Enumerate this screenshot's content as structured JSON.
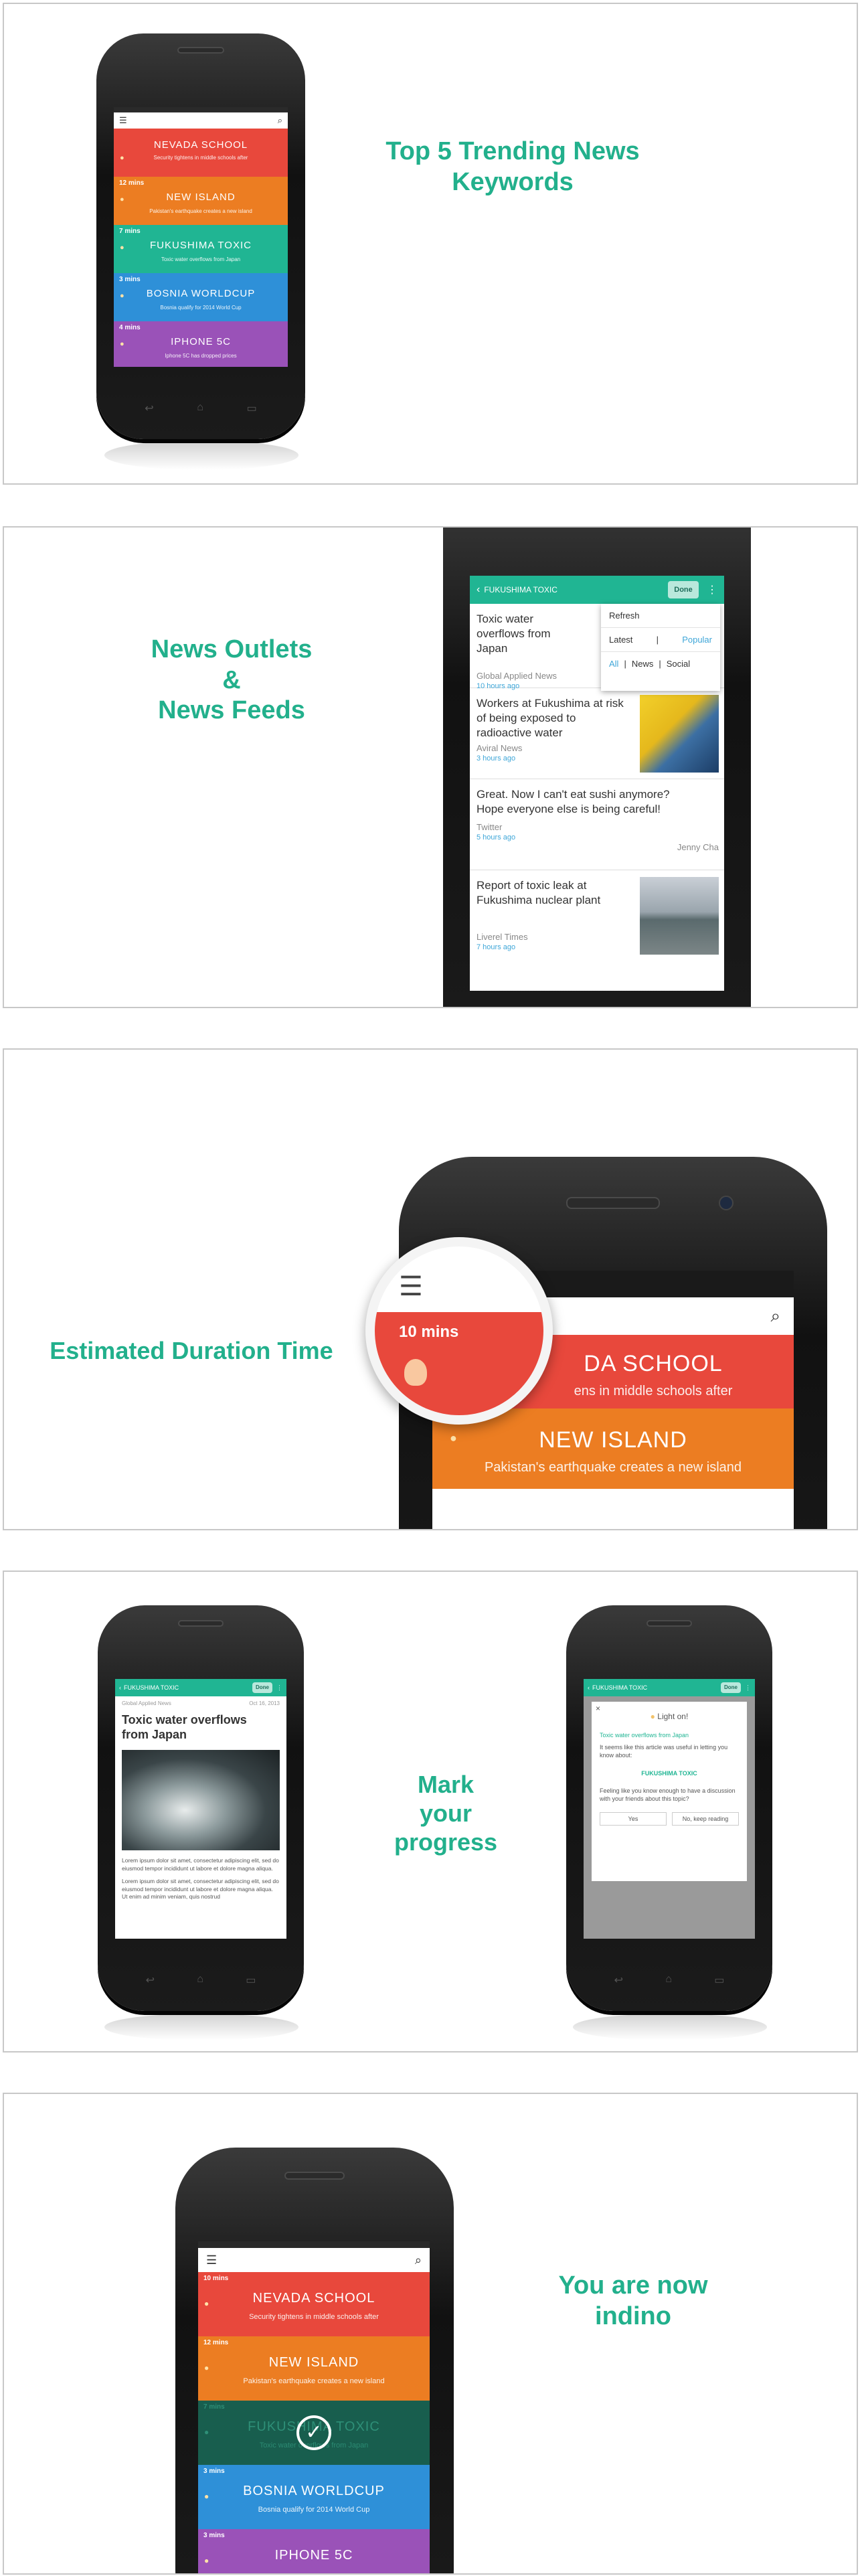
{
  "section1": {
    "caption": "Top 5 Trending News Keywords",
    "items": [
      {
        "time": "",
        "keyword": "NEVADA SCHOOL",
        "subtitle": "Security tightens in middle schools after",
        "color": "#e8483c"
      },
      {
        "time": "12 mins",
        "keyword": "NEW ISLAND",
        "subtitle": "Pakistan's earthquake creates a new island",
        "color": "#ec7d22"
      },
      {
        "time": "7 mins",
        "keyword": "FUKUSHIMA TOXIC",
        "subtitle": "Toxic water overflows from Japan",
        "color": "#20b593"
      },
      {
        "time": "3 mins",
        "keyword": "BOSNIA WORLDCUP",
        "subtitle": "Bosnia qualify for 2014 World Cup",
        "color": "#2e90d8"
      },
      {
        "time": "4 mins",
        "keyword": "IPHONE 5C",
        "subtitle": "Iphone 5C has dropped prices",
        "color": "#9a52b8"
      }
    ]
  },
  "section2": {
    "caption_line1": "News Outlets",
    "caption_line2": "&",
    "caption_line3": "News Feeds",
    "header_title": "FUKUSHIMA TOXIC",
    "done_label": "Done",
    "menu": {
      "refresh": "Refresh",
      "latest": "Latest",
      "sep1": "|",
      "popular": "Popular",
      "all": "All",
      "sep2": "|",
      "news": "News",
      "sep3": "|",
      "social": "Social"
    },
    "feed": [
      {
        "headline": "Toxic water overflows from Japan",
        "source": "Global Applied News",
        "ago": "10 hours ago",
        "author": ""
      },
      {
        "headline": "Workers at Fukushima at risk of being exposed to radioactive water",
        "source": "Aviral News",
        "ago": "3 hours ago",
        "author": ""
      },
      {
        "headline": "Great. Now I can't eat sushi anymore? Hope everyone else is being careful!",
        "source": "Twitter",
        "ago": "5 hours ago",
        "author": "Jenny Cha"
      },
      {
        "headline": "Report of toxic leak at Fukushima nuclear plant",
        "source": "Liverel Times",
        "ago": "7 hours ago",
        "author": ""
      }
    ]
  },
  "section3": {
    "caption": "Estimated Duration Time",
    "magnifier_time": "10 mins",
    "item1_keyword": "DA SCHOOL",
    "item1_subtitle": "ens in middle schools after",
    "item2_keyword": "NEW ISLAND",
    "item2_subtitle": "Pakistan's earthquake creates a new island"
  },
  "section4": {
    "caption_line1": "Mark",
    "caption_line2": "your",
    "caption_line3": "progress",
    "header_title": "FUKUSHIMA TOXIC",
    "done_label": "Done",
    "article": {
      "source": "Global Applied News",
      "date": "Oct 16, 2013",
      "title": "Toxic water overflows from Japan",
      "body1": "Lorem ipsum dolor sit amet, consectetur adipiscing elit, sed do eiusmod tempor incididunt ut labore et dolore magna aliqua.",
      "body2": "Lorem ipsum dolor sit amet, consectetur adipiscing elit, sed do eiusmod tempor incididunt ut labore et dolore magna aliqua. Ut enim ad minim veniam, quis nostrud"
    },
    "dialog": {
      "close": "×",
      "title": "Light on!",
      "article_title": "Toxic water overflows from Japan",
      "question": "It seems like this article was useful in letting you know about:",
      "keyword": "FUKUSHIMA TOXIC",
      "prompt": "Feeling like you know enough to have a discussion with your friends about this topic?",
      "yes": "Yes",
      "no": "No, keep reading"
    }
  },
  "section5": {
    "caption_line1": "You are now",
    "caption_line2": "indino",
    "items": [
      {
        "time": "10 mins",
        "keyword": "NEVADA SCHOOL",
        "subtitle": "Security tightens in middle schools after"
      },
      {
        "time": "12 mins",
        "keyword": "NEW ISLAND",
        "subtitle": "Pakistan's earthquake creates a new island"
      },
      {
        "time": "7 mins",
        "keyword": "FUKUSHIMA TOXIC",
        "subtitle": "Toxic water overflows from Japan"
      },
      {
        "time": "3 mins",
        "keyword": "BOSNIA WORLDCUP",
        "subtitle": "Bosnia qualify for 2014 World Cup"
      },
      {
        "time": "3 mins",
        "keyword": "IPHONE 5C",
        "subtitle": ""
      }
    ]
  }
}
